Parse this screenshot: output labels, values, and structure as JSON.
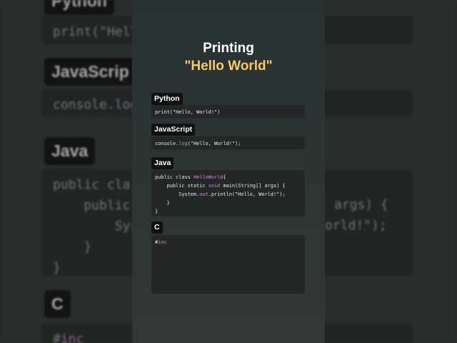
{
  "colors": {
    "accent": "#f7c76a",
    "panel": "#2e3533",
    "code_bg": "#242726",
    "label_bg": "#111111"
  },
  "header": {
    "title": "Printing",
    "subtitle": "\"Hello World\""
  },
  "python": {
    "label": "Python",
    "print": "print",
    "args": "(\"Hello, World!\")"
  },
  "javascript": {
    "label": "JavaScript",
    "obj": "console.",
    "method": "log",
    "args": "(\"Hello, World!\");"
  },
  "java": {
    "label": "Java",
    "l1_a": "public class ",
    "l1_cls": "HelloWorld",
    "l1_b": "{",
    "l2_a": "    public static ",
    "l2_void": "void",
    "l2_b": " main(String[] args) {",
    "l3_a": "        System.",
    "l3_out": "out",
    "l3_b": ".println(\"Hello, World!\");",
    "l4": "    }",
    "l5": "}"
  },
  "c": {
    "label": "C",
    "hash": "#",
    "inc": "inc"
  },
  "background": {
    "python_label": "Python",
    "python_code": "print(\"Hell",
    "js_label": "JavaScrip",
    "js_obj": "console.",
    "js_method": "log",
    "java_label": "Java",
    "java_l1": "public cla",
    "java_l2": "    public",
    "java_l2_right": "args) {",
    "java_l3": "        Sys",
    "java_l3_right": "orld!\");",
    "java_l4": "    }",
    "java_l5": "}",
    "c_label": "C",
    "c_hash": "#",
    "c_inc": "inc"
  }
}
